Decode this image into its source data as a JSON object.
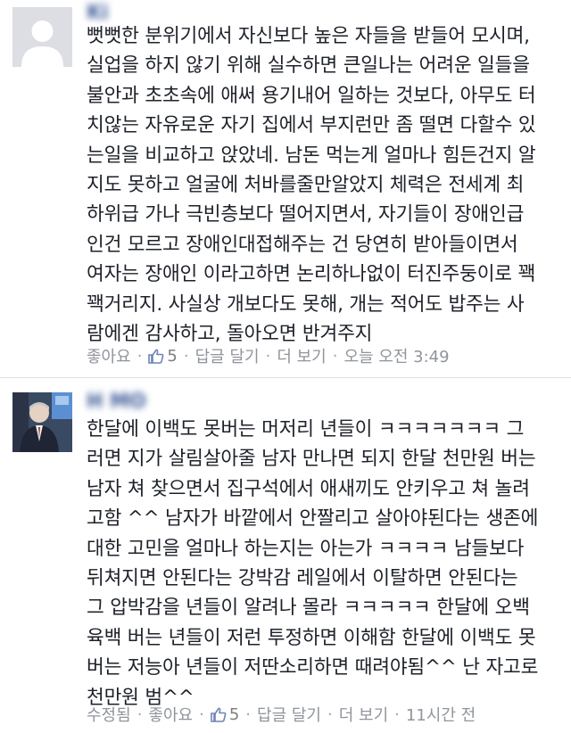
{
  "comments": [
    {
      "author": "Ki",
      "text": "뻣뻣한 분위기에서 자신보다 높은 자들을 받들어 모시며,\n실업을 하지 않기 위해 실수하면 큰일나는 어려운 일들을\n불안과 초초속에 애써 용기내어 일하는 것보다, 아무도 터\n치않는 자유로운 자기 집에서 부지런만 좀 떨면 다할수 있\n는일을 비교하고 앉았네. 남돈 먹는게 얼마나 힘든건지 알\n지도 못하고 얼굴에 처바를줄만알았지 체력은 전세계 최\n하위급 가나 극빈층보다 떨어지면서, 자기들이 장애인급\n인건 모르고 장애인대접해주는 건 당연히 받아들이면서\n여자는 장애인 이라고하면 논리하나없이 터진주둥이로 꽥\n꽥거리지. 사실상 개보다도 못해, 개는 적어도 밥주는 사\n람에겐 감사하고, 돌아오면 반겨주지",
      "like_label": "좋아요",
      "like_count": "5",
      "reply_label": "답글 달기",
      "more_label": "더 보기",
      "timestamp": "오늘 오전 3:49"
    },
    {
      "author": "H         MO",
      "text": "한달에 이백도 못버는 머저리 년들이 ㅋㅋㅋㅋㅋㅋㅋ 그\n러면 지가 살림살아줄 남자 만나면 되지 한달 천만원 버는\n남자 쳐 찾으면서 집구석에서 애새끼도 안키우고 쳐 놀려\n고함 ^^ 남자가 바깥에서 안짤리고 살아야된다는 생존에\n대한 고민을 얼마나 하는지는 아는가 ㅋㅋㅋㅋ 남들보다\n뒤쳐지면 안된다는 강박감 레일에서 이탈하면 안된다는\n그 압박감을 년들이 알려나 몰라 ㅋㅋㅋㅋㅋ 한달에 오백\n육백 버는 년들이 저런 투정하면 이해함 한달에 이백도 못\n버는 저능아 년들이 저딴소리하면 때려야됨^^ 난 자고로\n천만원 범^^",
      "edited_label": "수정됨",
      "like_label": "좋아요",
      "like_count": "5",
      "reply_label": "답글 달기",
      "more_label": "더 보기",
      "timestamp": "11시간 전"
    }
  ],
  "separator": "·",
  "icons": {
    "avatar_default": "default-avatar-icon",
    "like": "thumbs-up-icon"
  },
  "colors": {
    "link_gray": "#90949c",
    "text": "#1d2129",
    "name_blue": "#3b5998",
    "divider": "#dddfe2"
  }
}
